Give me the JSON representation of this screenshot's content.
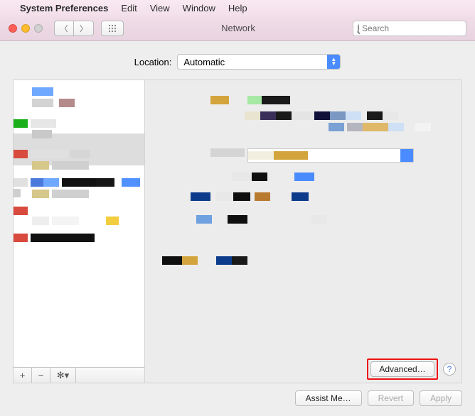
{
  "menubar": {
    "appname": "System Preferences",
    "items": [
      "Edit",
      "View",
      "Window",
      "Help"
    ]
  },
  "toolbar": {
    "window_title": "Network",
    "search_placeholder": "Search"
  },
  "location": {
    "label": "Location:",
    "value": "Automatic"
  },
  "sidebar": {
    "footer": {
      "add": "+",
      "remove": "−",
      "gear": "✻▾"
    }
  },
  "detail": {
    "advanced": "Advanced…",
    "help": "?"
  },
  "footer_buttons": {
    "assist": "Assist Me…",
    "revert": "Revert",
    "apply": "Apply"
  }
}
